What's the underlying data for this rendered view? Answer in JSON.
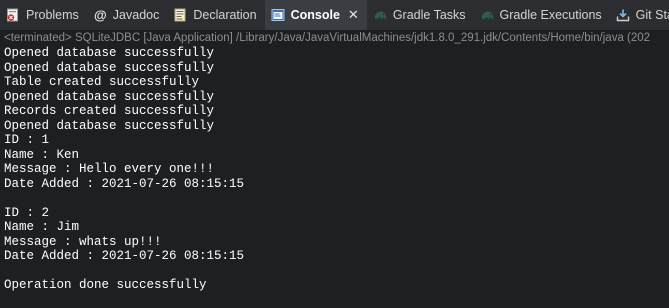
{
  "tabs": [
    {
      "label": "Problems",
      "icon": "problems-icon",
      "active": false
    },
    {
      "label": "Javadoc",
      "icon": "javadoc-icon",
      "active": false
    },
    {
      "label": "Declaration",
      "icon": "declaration-icon",
      "active": false
    },
    {
      "label": "Console",
      "icon": "console-icon",
      "active": true,
      "close": "✕"
    },
    {
      "label": "Gradle Tasks",
      "icon": "gradle-elephant-icon",
      "active": false
    },
    {
      "label": "Gradle Executions",
      "icon": "gradle-elephant-icon",
      "active": false
    },
    {
      "label": "Git Staging",
      "icon": "git-staging-icon",
      "active": false
    }
  ],
  "status": "<terminated> SQLiteJDBC [Java Application] /Library/Java/JavaVirtualMachines/jdk1.8.0_291.jdk/Contents/Home/bin/java  (202",
  "console_lines": [
    "Opened database successfully",
    "Opened database successfully",
    "Table created successfully",
    "Opened database successfully",
    "Records created successfully",
    "Opened database successfully",
    "ID : 1",
    "Name : Ken",
    "Message : Hello every one!!!",
    "Date Added : 2021-07-26 08:15:15",
    "",
    "ID : 2",
    "Name : Jim",
    "Message : whats up!!!",
    "Date Added : 2021-07-26 08:15:15",
    "",
    "Operation done successfully"
  ],
  "colors": {
    "background": "#1e1f22",
    "tabbar": "#2b2d30",
    "active_tab": "#3a3d41",
    "text": "#ffffff",
    "status_text": "#8e8e8e"
  }
}
